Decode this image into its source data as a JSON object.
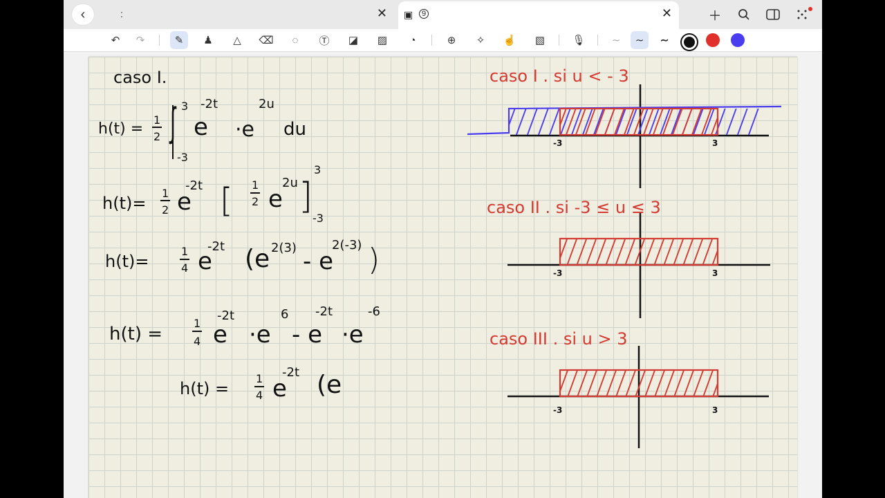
{
  "tabs": [
    {
      "title": ":",
      "close": "✕"
    },
    {
      "badge": "9",
      "close": "✕"
    }
  ],
  "icons": {
    "back": "chevron-left-icon",
    "new_tab": "plus-icon",
    "search": "search-icon",
    "sidebar": "sidebar-icon",
    "more": "dots-grid-icon"
  },
  "toolbar": {
    "colors": [
      "#111111",
      "#e0302c",
      "#4a3df0"
    ]
  },
  "notes": {
    "left": {
      "caso": "caso  I.",
      "l1_lhs": "h(t) = ",
      "l1_frac_n": "1",
      "l1_frac_d": "2",
      "l1_up": "3",
      "l1_low": "-3",
      "l1_e": "e",
      "l1_exp1": "-2t",
      "l1_dot": "·e",
      "l1_exp2": "2u",
      "l1_du": "du",
      "l2_lhs": "h(t)=",
      "l2_n": "1",
      "l2_d": "2",
      "l2_e": "e",
      "l2_exp": "-2t",
      "l2_open": "[",
      "l2_in_n": "1",
      "l2_in_d": "2",
      "l2_in_e": "e",
      "l2_in_exp": "2u",
      "l2_close": "]",
      "l2_up": "3",
      "l2_low": "-3",
      "l3_lhs": "h(t)=",
      "l3_n": "1",
      "l3_d": "4",
      "l3_e": "e",
      "l3_exp": "-2t",
      "l3_body": "(e",
      "l3_exp2": "2(3)",
      "l3_mid": "- e",
      "l3_exp3": "2(-3)",
      "l3_close": ")",
      "l4_lhs": "h(t) =",
      "l4_n": "1",
      "l4_d": "4",
      "l4_e1": "e",
      "l4_exp1": "-2t",
      "l4_dot1": "·e",
      "l4_exp2": "6",
      "l4_minus": "- e",
      "l4_exp3": "-2t",
      "l4_dot2": "·e",
      "l4_exp4": "-6",
      "l5_lhs": "h(t) =",
      "l5_n": "1",
      "l5_d": "4",
      "l5_e": "e",
      "l5_exp": "-2t",
      "l5_body": "(e"
    },
    "right": {
      "case1": "caso I . si   u < - 3",
      "case2": "caso II .  si   -3 ≤ u ≤ 3",
      "case3": "caso III .  si   u > 3",
      "tick_neg": "-3",
      "tick_pos": "3"
    }
  }
}
